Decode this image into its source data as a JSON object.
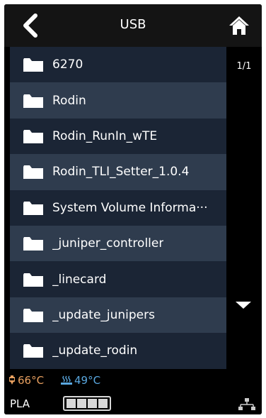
{
  "header": {
    "title": "USB",
    "back_icon": "chevron-left-icon",
    "home_icon": "home-icon"
  },
  "file_list": {
    "items": [
      {
        "label": "6270",
        "icon": "folder-icon"
      },
      {
        "label": "Rodin",
        "icon": "folder-icon"
      },
      {
        "label": "Rodin_RunIn_wTE",
        "icon": "folder-icon"
      },
      {
        "label": "Rodin_TLI_Setter_1.0.4",
        "icon": "folder-icon"
      },
      {
        "label": "System Volume Informa···",
        "icon": "folder-icon"
      },
      {
        "label": "_juniper_controller",
        "icon": "folder-icon"
      },
      {
        "label": "_linecard",
        "icon": "folder-icon"
      },
      {
        "label": "_update_junipers",
        "icon": "folder-icon"
      },
      {
        "label": "_update_rodin",
        "icon": "folder-icon"
      }
    ]
  },
  "pagination": {
    "indicator": "1/1",
    "scroll_icon": "triangle-down-icon"
  },
  "status": {
    "nozzle_temp": "66°C",
    "bed_temp": "49°C",
    "material": "PLA",
    "filament_level": 1.0,
    "network_icon": "network-icon"
  },
  "colors": {
    "background": "#000000",
    "row_dark": "#1b2535",
    "row_light": "#2f3c4e",
    "nozzle_temp": "#e8a060",
    "bed_temp": "#5aa8e0"
  }
}
